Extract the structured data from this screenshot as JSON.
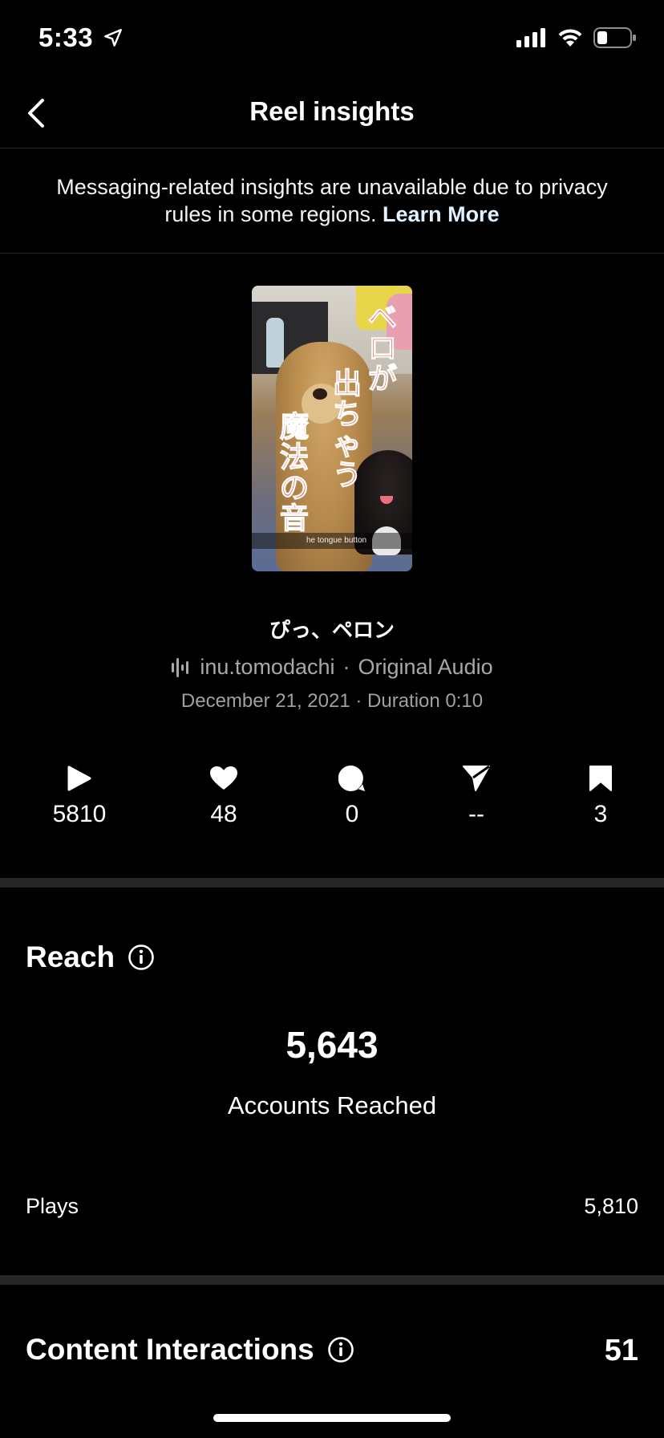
{
  "status_bar": {
    "time": "5:33"
  },
  "nav": {
    "title": "Reel insights"
  },
  "notice": {
    "text": "Messaging-related insights are unavailable due to privacy rules in some regions.",
    "link_label": "Learn More"
  },
  "thumbnail": {
    "caption_col1": "ベロが",
    "caption_col2": "出ちゃう",
    "caption_col3": "魔法の音",
    "subtitle": "he tongue button"
  },
  "reel": {
    "title": "ぴっ、ペロン",
    "audio_author": "inu.tomodachi",
    "audio_separator": "·",
    "audio_label": "Original Audio",
    "date_line": "December 21, 2021 · Duration 0:10"
  },
  "stats": {
    "plays": "5810",
    "likes": "48",
    "comments": "0",
    "shares": "--",
    "saves": "3"
  },
  "reach": {
    "title": "Reach",
    "accounts_reached": "5,643",
    "accounts_reached_label": "Accounts Reached",
    "plays_label": "Plays",
    "plays_value": "5,810"
  },
  "content_interactions": {
    "title": "Content Interactions",
    "value": "51"
  },
  "colors": {
    "background": "#000000",
    "divider": "#262626",
    "secondary_text": "#a8a8a8",
    "link": "#e0f1ff"
  }
}
